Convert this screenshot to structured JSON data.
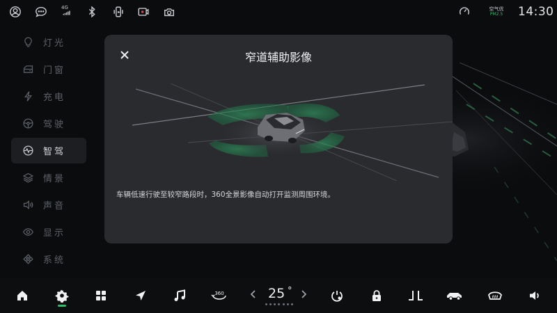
{
  "status_bar": {
    "network": "4G",
    "air_quality": {
      "title": "空气优",
      "subtitle": "PM2.5"
    },
    "time": "14:30"
  },
  "sidebar": {
    "items": [
      {
        "label": "灯光",
        "icon": "bulb-icon",
        "active": false
      },
      {
        "label": "门窗",
        "icon": "door-window-icon",
        "active": false
      },
      {
        "label": "充电",
        "icon": "lightning-icon",
        "active": false
      },
      {
        "label": "驾驶",
        "icon": "steering-wheel-icon",
        "active": false
      },
      {
        "label": "智驾",
        "icon": "smart-drive-icon",
        "active": true
      },
      {
        "label": "情景",
        "icon": "layers-icon",
        "active": false
      },
      {
        "label": "声音",
        "icon": "speaker-icon",
        "active": false
      },
      {
        "label": "显示",
        "icon": "eye-icon",
        "active": false
      },
      {
        "label": "系统",
        "icon": "diamond-grid-icon",
        "active": false
      }
    ]
  },
  "modal": {
    "title": "窄道辅助影像",
    "description": "车辆低速行驶至较窄路段时，360全景影像自动打开监测周围环境。"
  },
  "dock": {
    "temperature": "25",
    "temperature_unit": "°",
    "view_360_label": "360",
    "active_item": "settings-icon"
  },
  "colors": {
    "accent_green": "#2fbf6a",
    "modal_bg": "#2a2b2e",
    "screen_bg": "#0b0c0e"
  }
}
